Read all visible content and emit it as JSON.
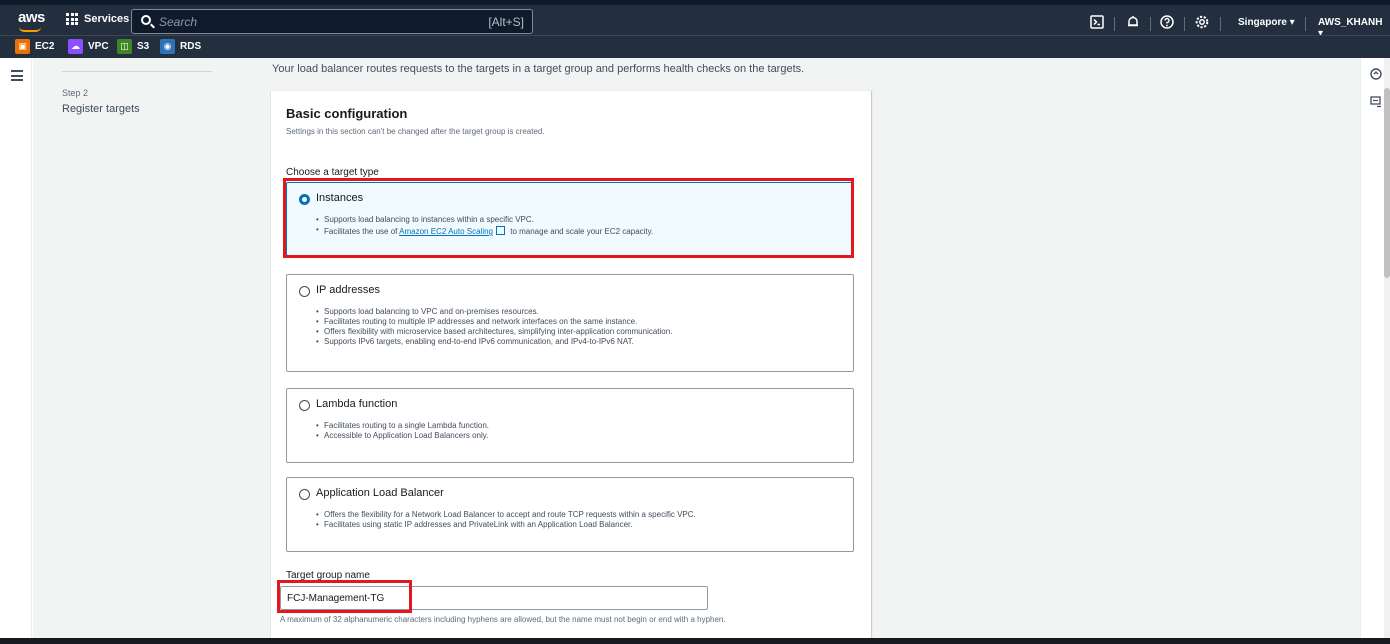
{
  "topnav": {
    "logo": "aws",
    "services_label": "Services",
    "search_placeholder": "Search",
    "search_shortcut": "[Alt+S]",
    "region": "Singapore ▾",
    "account": "AWS_KHANH ▾",
    "icons": [
      "cloudshell-icon",
      "bell-icon",
      "help-icon",
      "settings-icon"
    ]
  },
  "favorites": [
    {
      "label": "EC2",
      "icon": "ec2-icon",
      "color": "#ed7100"
    },
    {
      "label": "VPC",
      "icon": "vpc-icon",
      "color": "#8c4fff"
    },
    {
      "label": "S3",
      "icon": "s3-icon",
      "color": "#3f8624"
    },
    {
      "label": "RDS",
      "icon": "rds-icon",
      "color": "#2e73b8"
    }
  ],
  "steps": {
    "step2_label": "Step 2",
    "step2_title": "Register targets"
  },
  "intro": "Your load balancer routes requests to the targets in a target group and performs health checks on the targets.",
  "panel": {
    "title": "Basic configuration",
    "description": "Settings in this section can't be changed after the target group is created.",
    "target_type_label": "Choose a target type",
    "options": [
      {
        "title": "Instances",
        "selected": true,
        "bullets": [
          "Supports load balancing to instances within a specific VPC."
        ],
        "bullet2_prefix": "Facilitates the use of ",
        "bullet2_link": "Amazon EC2 Auto Scaling",
        "bullet2_suffix": " to manage and scale your EC2 capacity."
      },
      {
        "title": "IP addresses",
        "selected": false,
        "bullets": [
          "Supports load balancing to VPC and on-premises resources.",
          "Facilitates routing to multiple IP addresses and network interfaces on the same instance.",
          "Offers flexibility with microservice based architectures, simplifying inter-application communication.",
          "Supports IPv6 targets, enabling end-to-end IPv6 communication, and IPv4-to-IPv6 NAT."
        ]
      },
      {
        "title": "Lambda function",
        "selected": false,
        "bullets": [
          "Facilitates routing to a single Lambda function.",
          "Accessible to Application Load Balancers only."
        ]
      },
      {
        "title": "Application Load Balancer",
        "selected": false,
        "bullets": [
          "Offers the flexibility for a Network Load Balancer to accept and route TCP requests within a specific VPC.",
          "Facilitates using static IP addresses and PrivateLink with an Application Load Balancer."
        ]
      }
    ],
    "name_label": "Target group name",
    "name_value": "FCJ-Management-TG",
    "name_hint": "A maximum of 32 alphanumeric characters including hyphens are allowed, but the name must not begin or end with a hyphen."
  },
  "colors": {
    "nav_bg": "#232f3e",
    "selected_bg": "#f1faff",
    "accent": "#0073bb",
    "highlight": "#e3171e"
  }
}
